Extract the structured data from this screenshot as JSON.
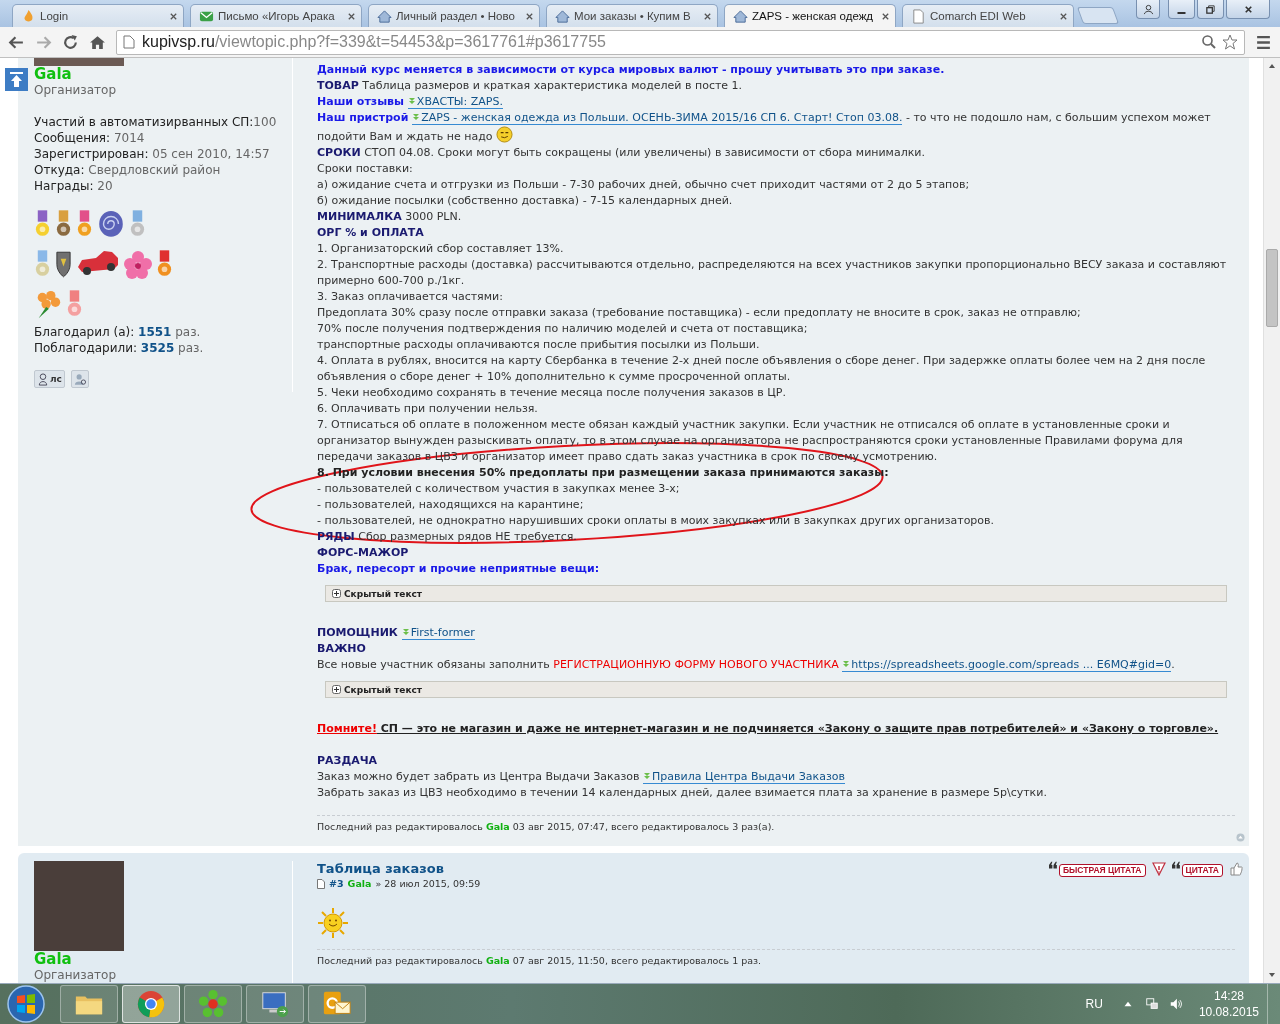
{
  "browser": {
    "tabs": [
      {
        "title": "Login",
        "kind": "site",
        "selected": false
      },
      {
        "title": "Письмо «Игорь Арака",
        "kind": "mail",
        "selected": false
      },
      {
        "title": "Личный раздел • Ново",
        "kind": "forum",
        "selected": false
      },
      {
        "title": "Мои заказы • Купим В",
        "kind": "forum",
        "selected": false
      },
      {
        "title": "ZAPS - женская одежд",
        "kind": "forum",
        "selected": true
      },
      {
        "title": "Comarch EDI Web",
        "kind": "page",
        "selected": false
      }
    ],
    "address": {
      "domain": "kupivsp.ru",
      "path": "/viewtopic.php?f=339&t=54453&p=3617761#p3617755"
    }
  },
  "post": {
    "author": {
      "name": "Gala",
      "rank": "Организатор"
    },
    "profile": [
      {
        "label": "Участий в автоматизирванных СП:",
        "value": "100"
      },
      {
        "label": "Сообщения: ",
        "value": "7014"
      },
      {
        "label": "Зарегистрирован: ",
        "value": "05 сен 2010, 14:57"
      },
      {
        "label": "Откуда: ",
        "value": "Свердловский район"
      },
      {
        "label": "Награды: ",
        "value": "20"
      }
    ],
    "thanks": [
      {
        "label": "Благодарил (а): ",
        "count": "1551",
        "unit": " раз."
      },
      {
        "label": "Поблагодарили: ",
        "count": "3525",
        "unit": " раз."
      }
    ],
    "pm_button": "лс",
    "body": [
      {
        "kind": "line",
        "parts": [
          {
            "kind": "emphasis",
            "text": "Данный курс меняется в зависимости от курса мировых валют - прошу учитывать это при заказе."
          }
        ]
      },
      {
        "kind": "line",
        "parts": [
          {
            "kind": "label",
            "text": "ТОВАР"
          },
          {
            "kind": "text",
            "text": " Таблица размеров и краткая характеристика моделей в посте 1."
          }
        ]
      },
      {
        "kind": "line",
        "parts": [
          {
            "kind": "emphasis",
            "text": "Наши отзывы "
          },
          {
            "kind": "link",
            "text": "ХВАСТЫ: ZAPS."
          }
        ]
      },
      {
        "kind": "line",
        "parts": [
          {
            "kind": "emphasis",
            "text": "Наш пристрой "
          },
          {
            "kind": "link",
            "text": "ZAPS - женская одежда из Польши. ОСЕНЬ-ЗИМА 2015/16 СП 6. Старт! Стоп 03.08."
          },
          {
            "kind": "text",
            "text": " - то что не подошло нам, с большим успехом может подойти Вам и ждать не надо "
          },
          {
            "kind": "smiley"
          }
        ]
      },
      {
        "kind": "line",
        "parts": [
          {
            "kind": "label",
            "text": "СРОКИ"
          },
          {
            "kind": "text",
            "text": " СТОП 04.08. Сроки могут быть сокращены (или увеличены) в зависимости от сбора минималки."
          }
        ]
      },
      {
        "kind": "line",
        "parts": [
          {
            "kind": "text",
            "text": "Сроки поставки:"
          }
        ]
      },
      {
        "kind": "line",
        "parts": [
          {
            "kind": "text",
            "text": "а) ожидание счета и отгрузки из Польши - 7-30 рабочих дней, обычно счет приходит частями от 2 до 5 этапов;"
          }
        ]
      },
      {
        "kind": "line",
        "parts": [
          {
            "kind": "text",
            "text": "б) ожидание посылки (собственно доставка) - 7-15 календарных дней."
          }
        ]
      },
      {
        "kind": "line",
        "parts": [
          {
            "kind": "label",
            "text": "МИНИМАЛКА"
          },
          {
            "kind": "text",
            "text": " 3000 PLN."
          }
        ]
      },
      {
        "kind": "line",
        "parts": [
          {
            "kind": "label",
            "text": "ОРГ % и ОПЛАТА"
          }
        ]
      },
      {
        "kind": "line",
        "parts": [
          {
            "kind": "text",
            "text": "1. Организаторский сбор составляет 13%."
          }
        ]
      },
      {
        "kind": "line",
        "parts": [
          {
            "kind": "text",
            "text": "2. Транспортные расходы (доставка) рассчитываются отдельно, распределяются на всех участников закупки пропорционально ВЕСУ заказа и составляют примерно 600-700 р./1кг."
          }
        ]
      },
      {
        "kind": "line",
        "parts": [
          {
            "kind": "text",
            "text": "3. Заказ оплачивается частями:"
          }
        ]
      },
      {
        "kind": "line",
        "parts": [
          {
            "kind": "text",
            "text": "Предоплата 30% сразу после отправки заказа (требование поставщика) - если предоплату не вносите в срок, заказ не отправлю;"
          }
        ]
      },
      {
        "kind": "line",
        "parts": [
          {
            "kind": "text",
            "text": "70% после получения подтверждения по наличию моделей и счета от поставщика;"
          }
        ]
      },
      {
        "kind": "line",
        "parts": [
          {
            "kind": "text",
            "text": "транспортные расходы оплачиваются после прибытия посылки из Польши."
          }
        ]
      },
      {
        "kind": "line",
        "parts": [
          {
            "kind": "text",
            "text": "4. Оплата в рублях, вносится на карту Сбербанка в течение 2-х дней после объявления о сборе денег. При задержке оплаты более чем на 2 дня после объявления о сборе денег + 10% дополнительно к сумме просроченной оплаты."
          }
        ]
      },
      {
        "kind": "line",
        "parts": [
          {
            "kind": "text",
            "text": "5. Чеки необходимо сохранять в течение месяца после получения заказов в ЦР."
          }
        ]
      },
      {
        "kind": "line",
        "parts": [
          {
            "kind": "text",
            "text": "6. Оплачивать при получении нельзя."
          }
        ]
      },
      {
        "kind": "line",
        "parts": [
          {
            "kind": "text",
            "text": "7. Отписаться об оплате в положенном месте обязан каждый участник закупки. Если участник не отписался об оплате в установленные сроки и организатор вынужден разыскивать оплату, то в этом случае на организатора не распространяются сроки установленные Правилами форума для передачи заказов в ЦВЗ и организатор имеет право сдать заказ участника в срок по своему усмотрению."
          }
        ]
      },
      {
        "kind": "line",
        "parts": [
          {
            "kind": "strong",
            "text": "8. При условии внесения 50% предоплаты при размещении заказа принимаются заказы:"
          }
        ]
      },
      {
        "kind": "line",
        "parts": [
          {
            "kind": "text",
            "text": "- пользователей с количеством участия в закупках менее 3-х;"
          }
        ]
      },
      {
        "kind": "line",
        "parts": [
          {
            "kind": "text",
            "text": "- пользователей, находящихся на карантине;"
          }
        ]
      },
      {
        "kind": "line",
        "parts": [
          {
            "kind": "text",
            "text": "- пользователей, не однократно нарушивших сроки оплаты в моих закупках или в закупках других организаторов."
          }
        ]
      },
      {
        "kind": "line",
        "parts": [
          {
            "kind": "label",
            "text": "РЯДЫ"
          },
          {
            "kind": "text",
            "text": " Сбор размерных рядов НЕ требуется."
          }
        ]
      },
      {
        "kind": "line",
        "parts": [
          {
            "kind": "label",
            "text": "ФОРС-МАЖОР"
          }
        ]
      },
      {
        "kind": "line",
        "parts": [
          {
            "kind": "emphasis",
            "text": "Брак, пересорт и прочие неприятные вещи:"
          }
        ]
      },
      {
        "kind": "spoiler",
        "text": "Скрытый текст"
      },
      {
        "kind": "gap"
      },
      {
        "kind": "line",
        "parts": [
          {
            "kind": "label",
            "text": "ПОМОЩНИК "
          },
          {
            "kind": "link",
            "text": "First-former"
          }
        ]
      },
      {
        "kind": "line",
        "parts": [
          {
            "kind": "label",
            "text": "ВАЖНО"
          }
        ]
      },
      {
        "kind": "line",
        "parts": [
          {
            "kind": "text",
            "text": "Все новые участник обязаны заполнить "
          },
          {
            "kind": "highlight",
            "text": "РЕГИСТРАЦИОННУЮ ФОРМУ НОВОГО УЧАСТНИКА "
          },
          {
            "kind": "link",
            "text": "https://spreadsheets.google.com/spreads ... E6MQ#gid=0"
          },
          {
            "kind": "text",
            "text": "."
          }
        ]
      },
      {
        "kind": "spoiler",
        "text": "Скрытый текст"
      },
      {
        "kind": "gap"
      },
      {
        "kind": "line",
        "parts": [
          {
            "kind": "alert",
            "text": "Помните!"
          },
          {
            "kind": "notice",
            "text": " СП — это не магазин и даже не интернет-магазин и не подчиняется «Закону о защите прав потребителей» и «Закону о торговле»."
          }
        ]
      },
      {
        "kind": "gap"
      },
      {
        "kind": "line",
        "parts": [
          {
            "kind": "label",
            "text": "РАЗДАЧА"
          }
        ]
      },
      {
        "kind": "line",
        "parts": [
          {
            "kind": "text",
            "text": "Заказ можно будет забрать из Центра Выдачи Заказов "
          },
          {
            "kind": "link",
            "text": "Правила Центра Выдачи Заказов"
          }
        ]
      },
      {
        "kind": "line",
        "parts": [
          {
            "kind": "text",
            "text": "Забрать заказ из ЦВЗ необходимо в течении 14 календарных дней, далее взимается плата за хранение в размере 5р\\сутки."
          }
        ]
      }
    ],
    "edit_note": {
      "prefix": "Последний раз редактировалось ",
      "author": "Gala",
      "rest": " 03 авг 2015, 07:47, всего редактировалось 3 раз(а)."
    }
  },
  "post2": {
    "author": {
      "name": "Gala",
      "rank": "Организатор"
    },
    "title": "Таблица заказов",
    "number": "#3",
    "author_name": "Gala",
    "date": "» 28 июл 2015, 09:59",
    "buttons": [
      "БЫСТРАЯ ЦИТАТА",
      "ЦИТАТА"
    ],
    "edit_note": {
      "prefix": "Последний раз редактировалось ",
      "author": "Gala",
      "rest": " 07 авг 2015, 11:50, всего редактировалось 1 раз."
    }
  },
  "taskbar": {
    "apps": [
      {
        "kind": "folder",
        "selected": false
      },
      {
        "kind": "browser",
        "selected": true
      },
      {
        "kind": "flower",
        "selected": false
      },
      {
        "kind": "remote",
        "selected": false
      },
      {
        "kind": "mail",
        "selected": false
      }
    ],
    "language": "RU",
    "time": "14:28",
    "date": "10.08.2015"
  }
}
